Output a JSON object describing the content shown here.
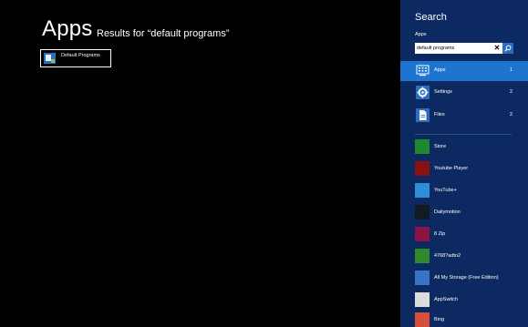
{
  "main": {
    "title": "Apps",
    "results_for": "Results for “default programs”",
    "results": [
      {
        "label": "Default Programs",
        "icon": "default-programs-icon"
      }
    ]
  },
  "search_pane": {
    "title": "Search",
    "scope_label": "Apps",
    "search": {
      "value": "default programs",
      "clear_icon": "close-icon",
      "go_icon": "search-icon"
    },
    "scopes": [
      {
        "label": "Apps",
        "count": "1",
        "icon": "apps-icon",
        "selected": true
      },
      {
        "label": "Settings",
        "count": "2",
        "icon": "gear-icon",
        "selected": false
      },
      {
        "label": "Files",
        "count": "2",
        "icon": "file-icon",
        "selected": false
      }
    ],
    "apps": [
      {
        "label": "Store",
        "color": "#1d8a2f"
      },
      {
        "label": "Youtube Player",
        "color": "#8a1113"
      },
      {
        "label": "YouTube+",
        "color": "#2d8dd8"
      },
      {
        "label": "Dailymotion",
        "color": "#131a24"
      },
      {
        "label": "8 Zip",
        "color": "#8a1443"
      },
      {
        "label": "4768?adtn2",
        "color": "#2f8a2c"
      },
      {
        "label": "All My Storage (Free Edition)",
        "color": "#3a72c8"
      },
      {
        "label": "AppSwitch",
        "color": "#dcdcdc"
      },
      {
        "label": "Bing",
        "color": "#d9503a"
      }
    ]
  },
  "colors": {
    "background": "#000000",
    "pane": "#0c2a61",
    "selected": "#1e75d0",
    "accent": "#2b6dc1"
  }
}
